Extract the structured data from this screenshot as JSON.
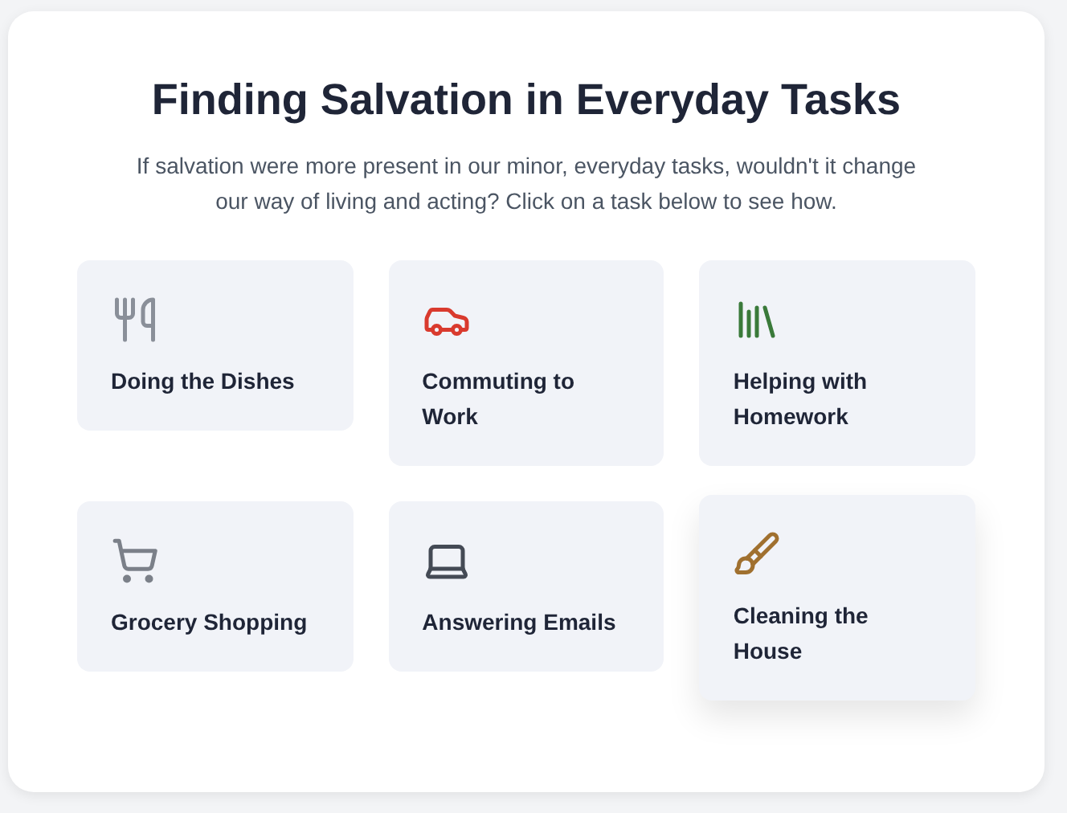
{
  "title": "Finding Salvation in Everyday Tasks",
  "subtitle": "If salvation were more present in our minor, everyday tasks, wouldn't it change our way of living and acting? Click on a task below to see how.",
  "tasks": [
    {
      "label": "Doing the Dishes",
      "raised": false
    },
    {
      "label": "Commuting to Work",
      "raised": false
    },
    {
      "label": "Helping with Homework",
      "raised": false
    },
    {
      "label": "Grocery Shopping",
      "raised": false
    },
    {
      "label": "Answering Emails",
      "raised": false
    },
    {
      "label": "Cleaning the House",
      "raised": true
    }
  ]
}
